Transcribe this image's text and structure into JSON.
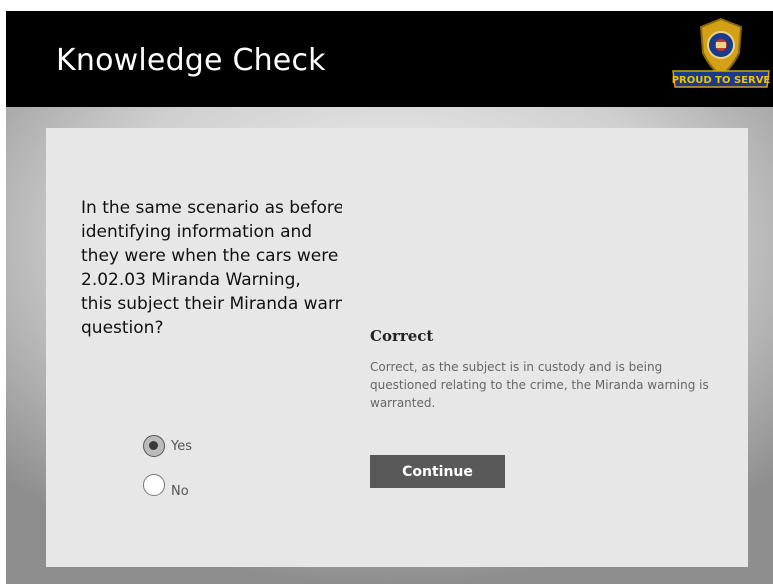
{
  "header": {
    "title": "Knowledge Check",
    "badge": {
      "icon": "police-badge-icon",
      "text": "PROUD TO SERVE",
      "colors": {
        "shield": "#d4a017",
        "ribbon": "#1a3a8a"
      }
    }
  },
  "question": {
    "lines": [
      "In the same scenario as before",
      "identifying information and",
      "they were when the cars were",
      "2.02.03 Miranda Warning,",
      "this subject their Miranda warning?",
      "question?"
    ],
    "options": [
      {
        "label": "Yes",
        "selected": true
      },
      {
        "label": "No",
        "selected": false
      }
    ]
  },
  "feedback": {
    "title": "Correct",
    "text": "Correct, as the subject is in custody and is being questioned relating to the crime, the Miranda warning is warranted.",
    "button": "Continue"
  }
}
